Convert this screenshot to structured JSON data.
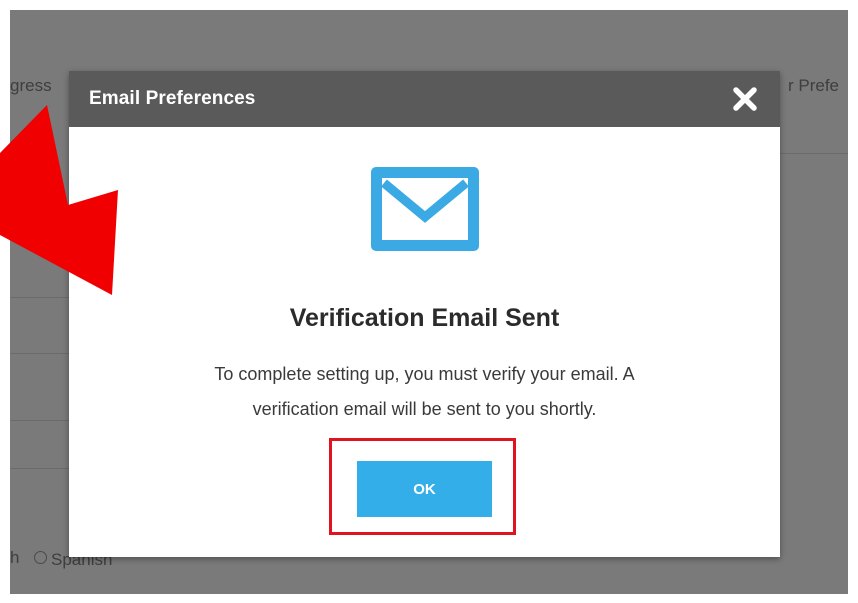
{
  "background": {
    "left_fragment_top": "gress",
    "right_fragment_top": "r Prefe",
    "bottom_fragment": "h",
    "bottom_option": "Spanish"
  },
  "modal": {
    "title": "Email Preferences",
    "close_icon": "close-icon",
    "mail_icon": "envelope-icon",
    "heading": "Verification Email Sent",
    "message": "To complete setting up, you must verify your email. A verification email will be sent to you shortly.",
    "ok_label": "OK"
  },
  "colors": {
    "header_bg": "#5a5a5a",
    "accent": "#34aee9",
    "annotation_red": "#e01420",
    "overlay": "#7a7a7a"
  }
}
